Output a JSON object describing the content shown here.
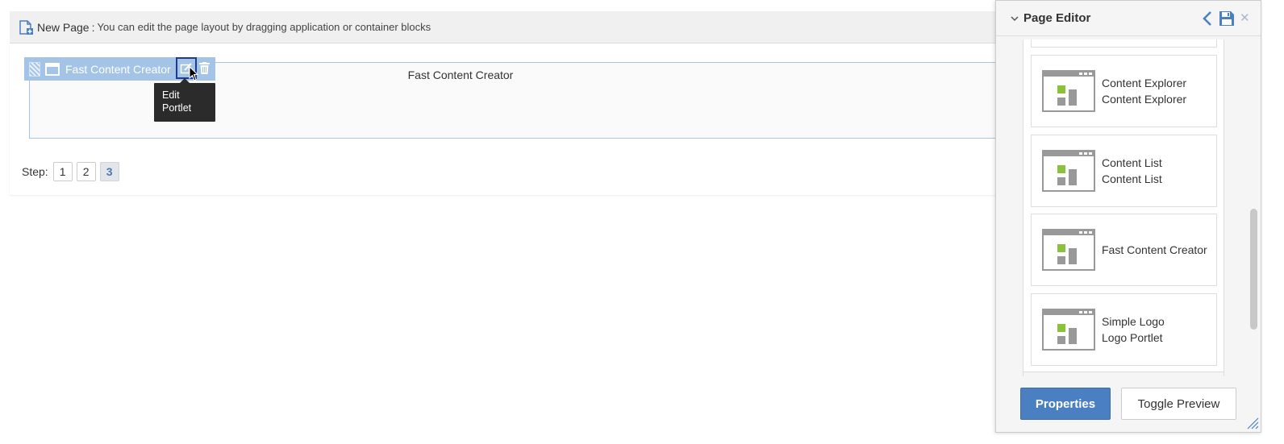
{
  "header": {
    "title": "New Page",
    "separator": ":",
    "description": "You can edit the page layout by dragging application or container blocks"
  },
  "portlet": {
    "toolbar_title": "Fast Content Creator",
    "body_title": "Fast Content Creator",
    "tooltip": "Edit Portlet"
  },
  "steps": {
    "label": "Step:",
    "items": [
      "1",
      "2",
      "3"
    ],
    "active": "3"
  },
  "editor": {
    "title": "Page Editor",
    "apps": [
      {
        "name": "Content Explorer",
        "subtitle": "Content Explorer"
      },
      {
        "name": "Content List",
        "subtitle": "Content List"
      },
      {
        "name": "Fast Content Creator",
        "subtitle": ""
      },
      {
        "name": "Simple Logo",
        "subtitle": "Logo Portlet"
      }
    ],
    "properties_label": "Properties",
    "toggle_preview_label": "Toggle Preview"
  },
  "colors": {
    "accent": "#4a7fc1",
    "toolbar": "#a3c4e6",
    "thumb_green": "#8ac33a",
    "thumb_gray": "#999999"
  }
}
